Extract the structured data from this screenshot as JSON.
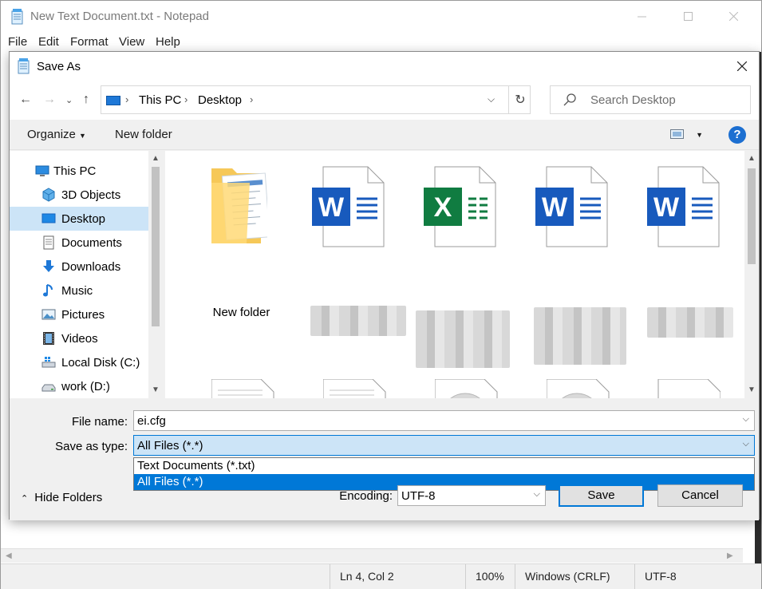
{
  "notepad": {
    "title": "New Text Document.txt - Notepad",
    "menu": [
      "File",
      "Edit",
      "Format",
      "View",
      "Help"
    ],
    "status": {
      "position": "Ln 4, Col 2",
      "zoom": "100%",
      "line_ending": "Windows (CRLF)",
      "encoding": "UTF-8"
    }
  },
  "dialog": {
    "title": "Save As",
    "breadcrumb": [
      "This PC",
      "Desktop"
    ],
    "search_placeholder": "Search Desktop",
    "toolbar": {
      "organize": "Organize",
      "new_folder": "New folder"
    },
    "nav_items": [
      {
        "label": "This PC",
        "icon": "computer-icon"
      },
      {
        "label": "3D Objects",
        "icon": "cube-icon"
      },
      {
        "label": "Desktop",
        "icon": "desktop-icon",
        "selected": true
      },
      {
        "label": "Documents",
        "icon": "documents-icon"
      },
      {
        "label": "Downloads",
        "icon": "download-arrow-icon"
      },
      {
        "label": "Music",
        "icon": "music-note-icon"
      },
      {
        "label": "Pictures",
        "icon": "pictures-icon"
      },
      {
        "label": "Videos",
        "icon": "film-icon"
      },
      {
        "label": "Local Disk (C:)",
        "icon": "windows-drive-icon"
      },
      {
        "label": "work (D:)",
        "icon": "drive-icon"
      }
    ],
    "files": [
      {
        "label": "New folder",
        "type": "folder"
      },
      {
        "label": "",
        "type": "word"
      },
      {
        "label": "",
        "type": "excel"
      },
      {
        "label": "",
        "type": "word"
      },
      {
        "label": "",
        "type": "word"
      },
      {
        "label": "",
        "type": "text"
      },
      {
        "label": "",
        "type": "text"
      },
      {
        "label": "",
        "type": "disc"
      },
      {
        "label": "",
        "type": "disc"
      },
      {
        "label": "",
        "type": "excel"
      }
    ],
    "file_name_label": "File name:",
    "file_name_value": "ei.cfg",
    "save_type_label": "Save as type:",
    "save_type_value": "All Files  (*.*)",
    "save_type_options": [
      "Text Documents (*.txt)",
      "All Files  (*.*)"
    ],
    "encoding_label": "Encoding:",
    "encoding_value": "UTF-8",
    "save_button": "Save",
    "cancel_button": "Cancel",
    "hide_folders": "Hide Folders",
    "colors": {
      "accent": "#0078d7",
      "selection": "#cce4f7",
      "word": "#185abd",
      "excel": "#107c41"
    }
  }
}
